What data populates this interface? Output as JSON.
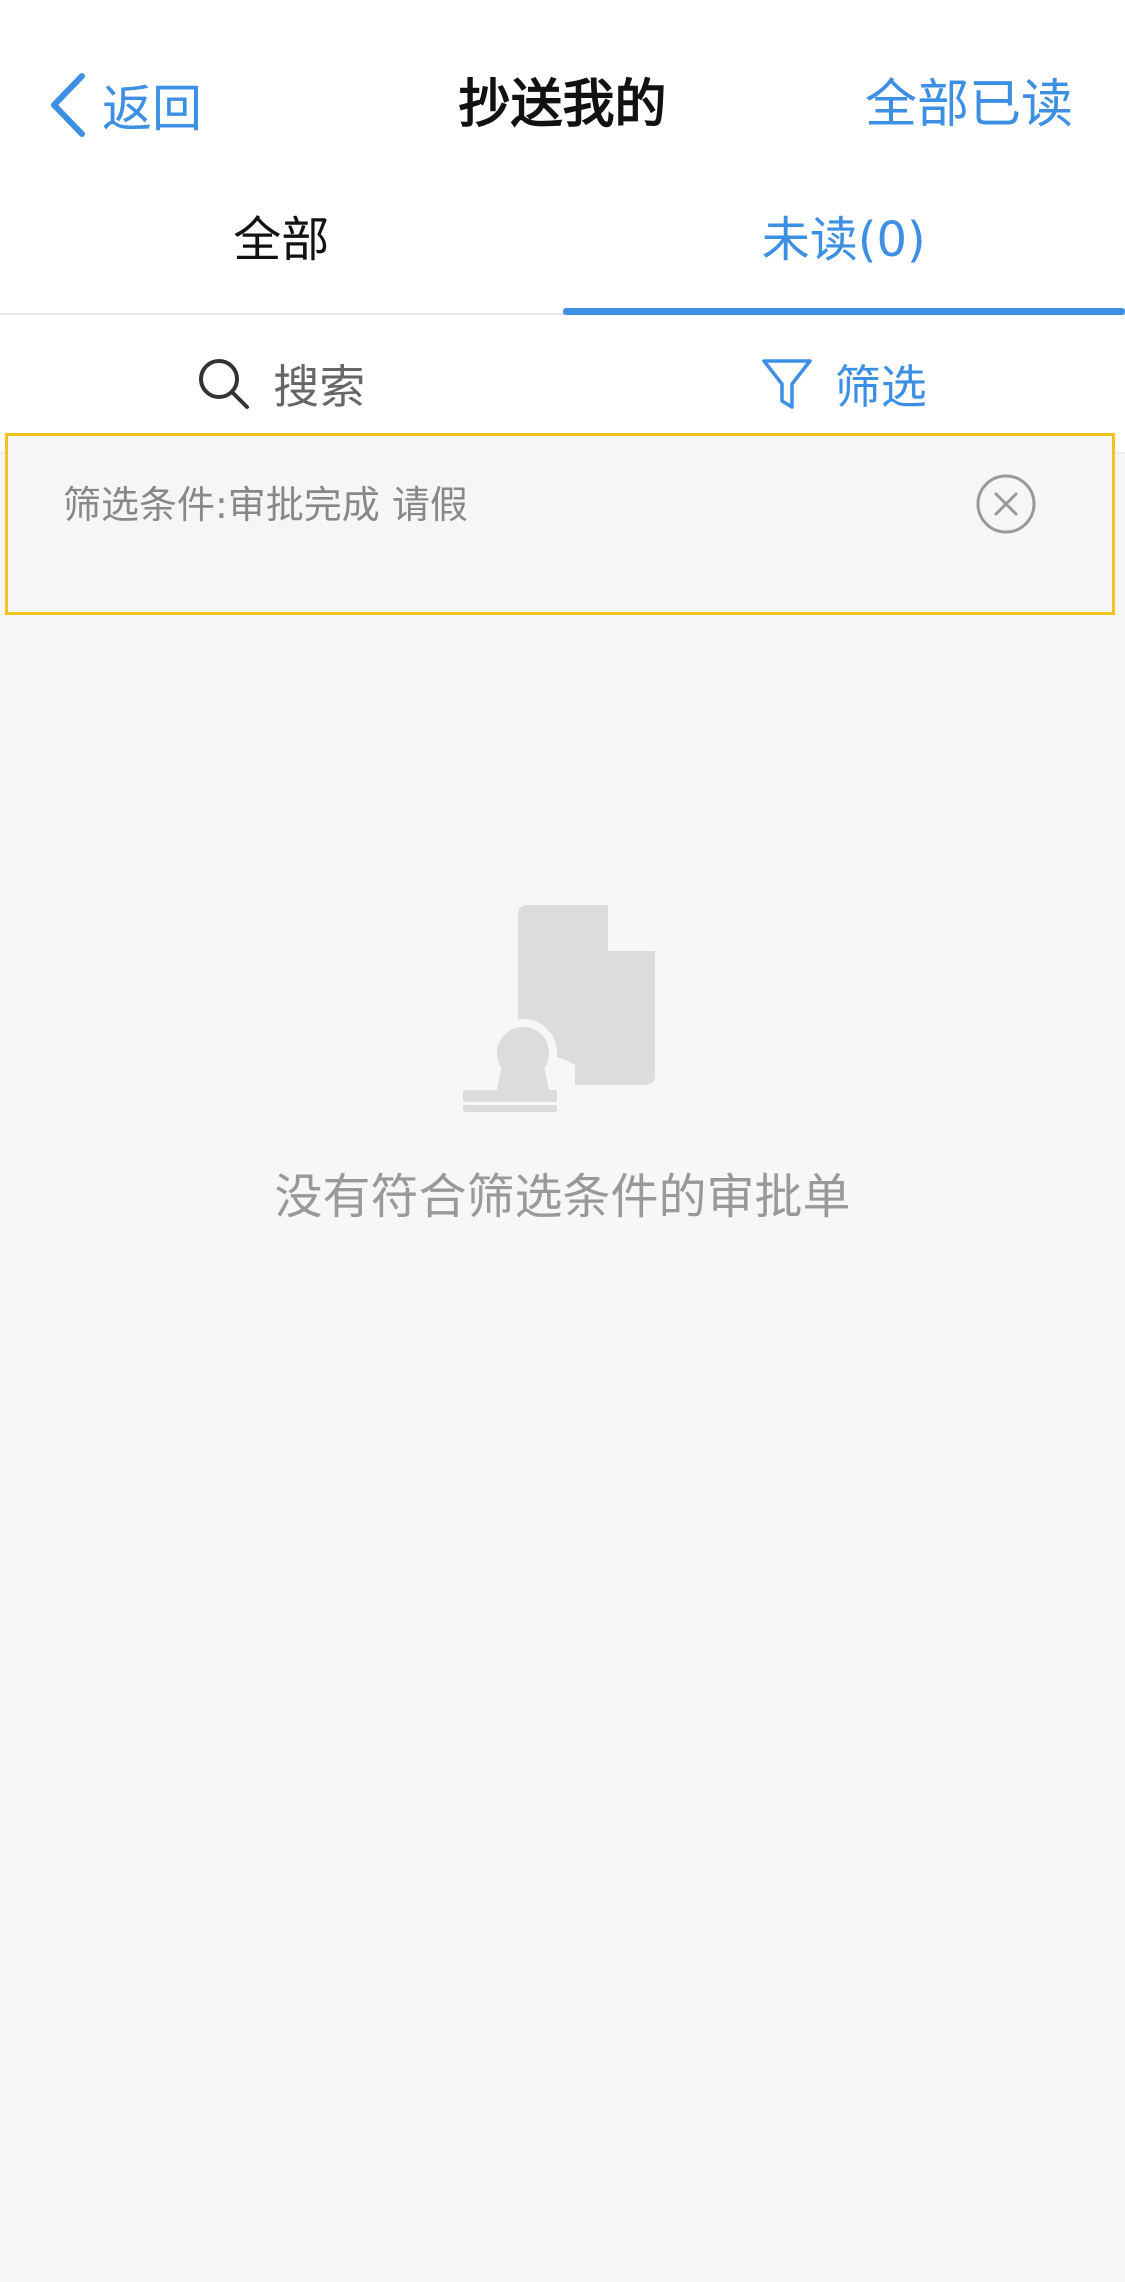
{
  "nav": {
    "back_label": "返回",
    "title": "抄送我的",
    "mark_all_read": "全部已读"
  },
  "tabs": [
    {
      "label": "全部",
      "active": false
    },
    {
      "label": "未读(0)",
      "active": true
    }
  ],
  "toolbar": {
    "search_label": "搜索",
    "filter_label": "筛选"
  },
  "filter": {
    "condition_text": "筛选条件:审批完成  请假"
  },
  "empty": {
    "message": "没有符合筛选条件的审批单"
  },
  "colors": {
    "accent": "#3d8fe4",
    "highlight_border": "#f2c41b",
    "background": "#f7f7f7"
  }
}
